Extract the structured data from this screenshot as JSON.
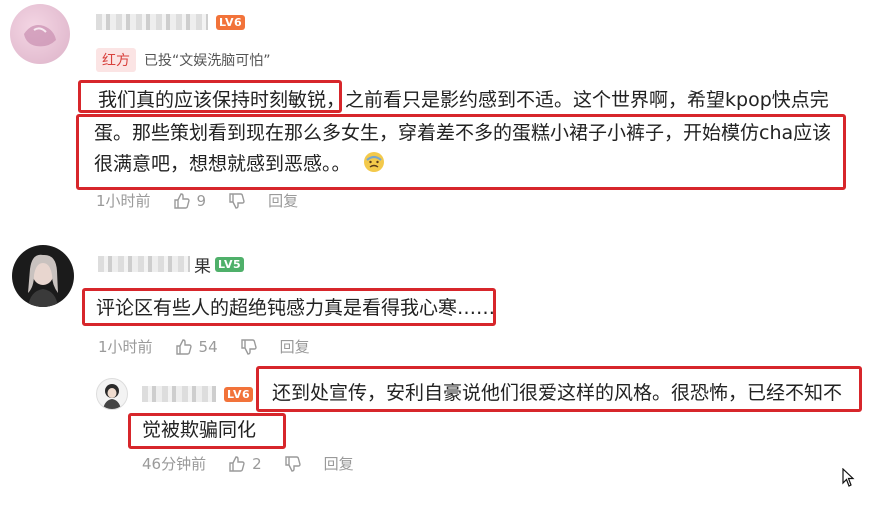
{
  "comments": [
    {
      "name_tail": "",
      "level": "LV6",
      "vote_badge": "红方",
      "vote_text": "已投“文娱洗脑可怕”",
      "lines": [
        "我们真的应该保持时刻敏锐，之前看只是影约感到不适。这个世界啊，希望kpop快点完",
        "蛋。那些策划看到现在那么多女生，穿着差不多的蛋糕小裙子小裤子，开始模仿cha应该",
        "很满意吧，想想就感到恶感。。"
      ],
      "time": "1小时前",
      "likes": "9",
      "reply": "回复"
    },
    {
      "name_tail": "果",
      "level": "LV5",
      "lines": [
        "评论区有些人的超绝钝感力真是看得我心寒……"
      ],
      "time": "1小时前",
      "likes": "54",
      "reply": "回复"
    },
    {
      "name_tail": "",
      "level": "LV6",
      "lines": [
        "还到处宣传，安利自豪说他们很爱这样的风格。很恐怖，已经不知不",
        "觉被欺骗同化"
      ],
      "time": "46分钟前",
      "likes": "2",
      "reply": "回复"
    }
  ],
  "colors": {
    "highlight_box": "#d7262b",
    "level_orange": "#f2733a",
    "level_green": "#4fb06a",
    "vote_badge": "#d8403c"
  }
}
